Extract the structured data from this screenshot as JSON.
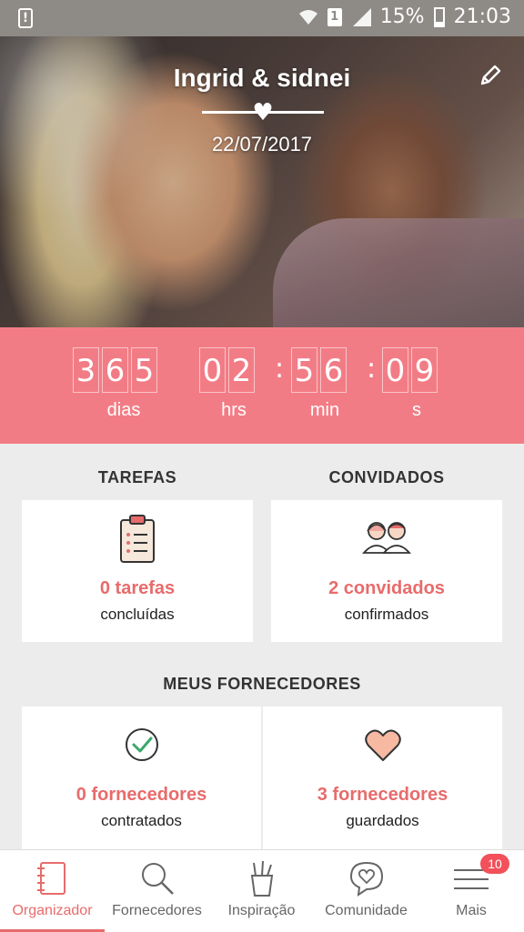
{
  "status_bar": {
    "battery": "15%",
    "time": "21:03",
    "sim_label": "1",
    "alert": "!"
  },
  "hero": {
    "couple_name": "Ingrid & sidnei",
    "date": "22/07/2017",
    "heart": "♥"
  },
  "countdown": {
    "days": [
      "3",
      "6",
      "5"
    ],
    "hours": [
      "0",
      "2"
    ],
    "minutes": [
      "5",
      "6"
    ],
    "seconds": [
      "0",
      "9"
    ],
    "labels": {
      "days": "dias",
      "hours": "hrs",
      "minutes": "min",
      "seconds": "s"
    },
    "separator": ":"
  },
  "tasks": {
    "title": "TAREFAS",
    "count": "0 tarefas",
    "sub": "concluídas"
  },
  "guests": {
    "title": "CONVIDADOS",
    "count": "2 convidados",
    "sub": "confirmados"
  },
  "vendors": {
    "title": "MEUS FORNECEDORES",
    "hired": {
      "count": "0 fornecedores",
      "sub": "contratados"
    },
    "saved": {
      "count": "3 fornecedores",
      "sub": "guardados"
    }
  },
  "nav": {
    "items": [
      {
        "label": "Organizador"
      },
      {
        "label": "Fornecedores"
      },
      {
        "label": "Inspiração"
      },
      {
        "label": "Comunidade"
      },
      {
        "label": "Mais"
      }
    ],
    "badge": "10"
  },
  "colors": {
    "accent": "#f27c85",
    "accent_text": "#e86b6b",
    "status_bar": "#8e8a86",
    "check": "#3aa86b"
  }
}
